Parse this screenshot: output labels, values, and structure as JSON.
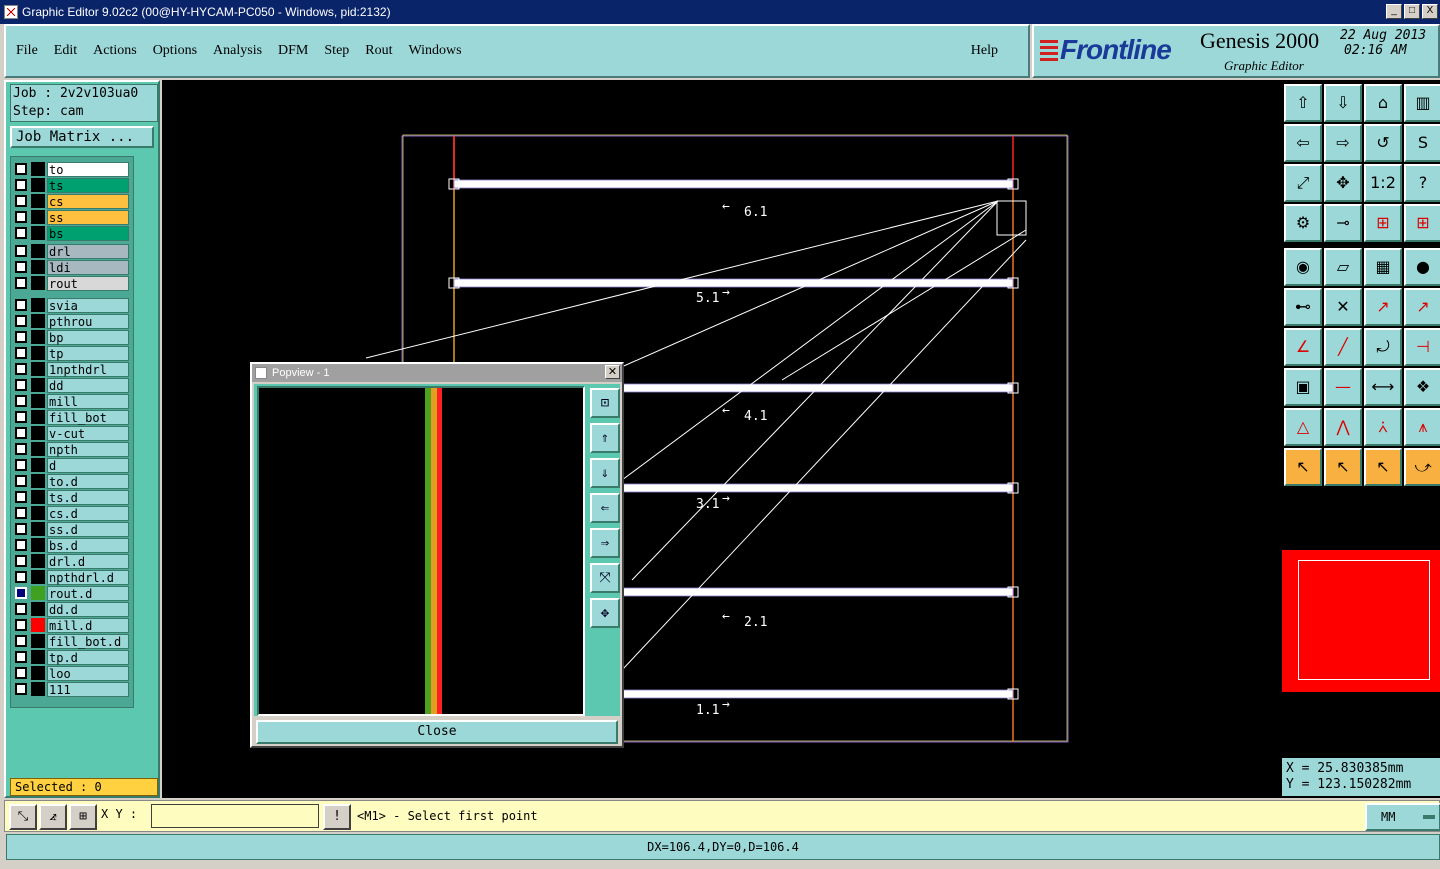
{
  "window": {
    "title": "Graphic Editor 9.02c2 (00@HY-HYCAM-PC050 - Windows, pid:2132)",
    "min_label": "_",
    "max_label": "□",
    "close_label": "X"
  },
  "menu": {
    "items": [
      "File",
      "Edit",
      "Actions",
      "Options",
      "Analysis",
      "DFM",
      "Step",
      "Rout",
      "Windows"
    ],
    "help": "Help"
  },
  "brand": {
    "logo": "Frontline",
    "product": "Genesis 2000",
    "subtitle": "Graphic Editor",
    "date": "22 Aug 2013",
    "time": "02:16 AM"
  },
  "job": {
    "job_line": "Job : 2v2v103ua0",
    "step_line": "Step: cam",
    "matrix_button": "Job Matrix ..."
  },
  "layers": [
    [
      {
        "name": "to",
        "color": "#ffffff"
      },
      {
        "name": "ts",
        "color": "#00a070"
      },
      {
        "name": "cs",
        "color": "#ffc040"
      },
      {
        "name": "ss",
        "color": "#ffc040"
      },
      {
        "name": "bs",
        "color": "#00a070"
      }
    ],
    [
      {
        "name": "drl",
        "color": "#a8b8c0"
      },
      {
        "name": "ldi",
        "color": "#a8b8c0"
      },
      {
        "name": "rout",
        "color": "#d8d8d8"
      }
    ],
    [
      {
        "name": "svia",
        "color": "#9cd8d8"
      },
      {
        "name": "pthrou",
        "color": "#9cd8d8"
      },
      {
        "name": "bp",
        "color": "#9cd8d8"
      },
      {
        "name": "tp",
        "color": "#9cd8d8"
      },
      {
        "name": "1npthdrl",
        "color": "#9cd8d8"
      },
      {
        "name": "dd",
        "color": "#9cd8d8"
      },
      {
        "name": "mill",
        "color": "#9cd8d8"
      },
      {
        "name": "fill_bot",
        "color": "#9cd8d8"
      },
      {
        "name": "v-cut",
        "color": "#9cd8d8"
      },
      {
        "name": "npth",
        "color": "#9cd8d8"
      },
      {
        "name": "d",
        "color": "#9cd8d8"
      },
      {
        "name": "to.d",
        "color": "#9cd8d8"
      },
      {
        "name": "ts.d",
        "color": "#9cd8d8"
      },
      {
        "name": "cs.d",
        "color": "#9cd8d8"
      },
      {
        "name": "ss.d",
        "color": "#9cd8d8"
      },
      {
        "name": "bs.d",
        "color": "#9cd8d8"
      },
      {
        "name": "drl.d",
        "color": "#9cd8d8"
      },
      {
        "name": "npthdrl.d",
        "color": "#9cd8d8"
      },
      {
        "name": "rout.d",
        "color": "#9cd8d8",
        "active": true,
        "swatch": "#40a020"
      },
      {
        "name": "dd.d",
        "color": "#9cd8d8"
      },
      {
        "name": "mill.d",
        "color": "#9cd8d8",
        "swatch": "#ff0000"
      },
      {
        "name": "fill_bot.d",
        "color": "#9cd8d8"
      },
      {
        "name": "tp.d",
        "color": "#9cd8d8"
      },
      {
        "name": "loo",
        "color": "#9cd8d8"
      },
      {
        "name": "111",
        "color": "#9cd8d8"
      }
    ]
  ],
  "selected": "Selected : 0",
  "canvas_labels": [
    "6.1",
    "5.1",
    "4.1",
    "3.1",
    "2.1",
    "1.1"
  ],
  "popview": {
    "title": "Popview - 1",
    "close_button": "Close"
  },
  "coords": {
    "x": "X = 25.830385mm",
    "y": "Y = 123.150282mm"
  },
  "status": {
    "xy_label": "X Y :",
    "xy_value": "",
    "info_button": "!",
    "prompt": "<M1> - Select first point",
    "units": "MM",
    "measure": "DX=106.4,DY=0,D=106.4"
  },
  "colors": {
    "titlebar": "#0a246a",
    "panel": "#9cd8d8",
    "left_bg": "#5cc8b0",
    "orange_tool": "#f8b040",
    "minimap": "#ff0000"
  }
}
